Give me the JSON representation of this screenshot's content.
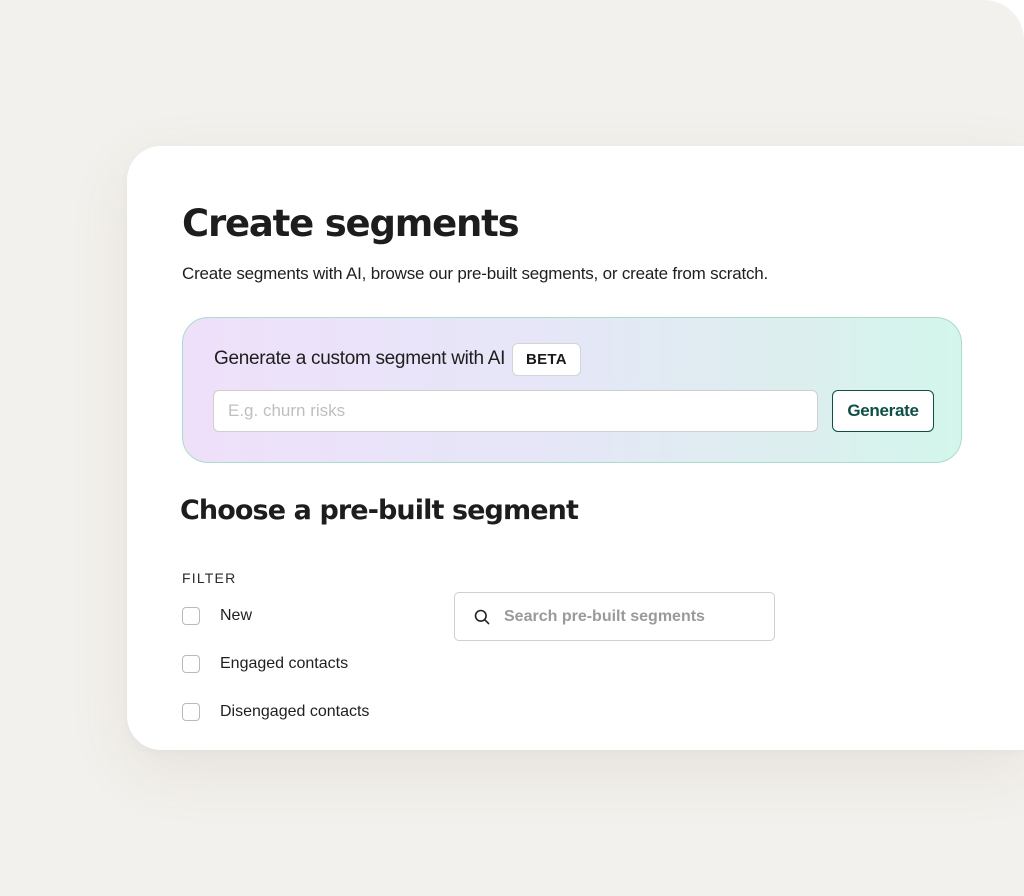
{
  "header": {
    "title": "Create segments",
    "subtitle": "Create segments with AI, browse our pre-built segments, or create from scratch."
  },
  "ai_generator": {
    "title": "Generate a custom segment with AI",
    "badge": "BETA",
    "input_placeholder": "E.g. churn risks",
    "input_value": "",
    "button_label": "Generate"
  },
  "prebuilt": {
    "title": "Choose a pre-built segment",
    "filter_heading": "FILTER",
    "filters": [
      {
        "label": "New",
        "checked": false
      },
      {
        "label": "Engaged contacts",
        "checked": false
      },
      {
        "label": "Disengaged contacts",
        "checked": false
      }
    ],
    "search": {
      "icon": "search-icon",
      "placeholder": "Search pre-built segments",
      "value": ""
    }
  },
  "colors": {
    "accent": "#0f4f45",
    "background": "#f3f1ed",
    "panel_gradient_start": "#efe0fa",
    "panel_gradient_end": "#d3f6ec"
  }
}
